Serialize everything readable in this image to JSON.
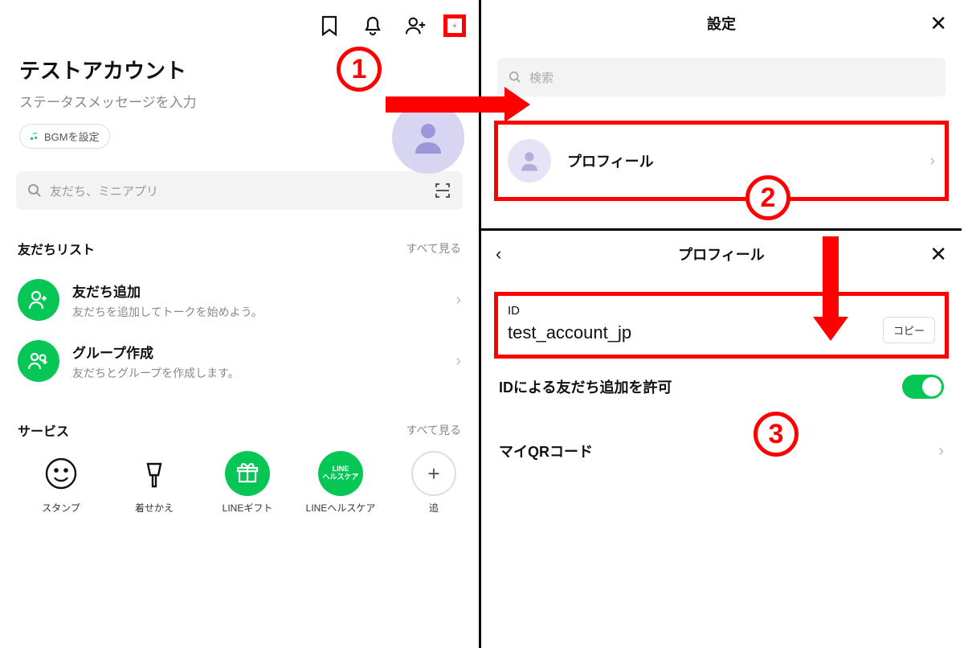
{
  "left": {
    "account_name": "テストアカウント",
    "status_placeholder": "ステータスメッセージを入力",
    "bgm_label": "BGMを設定",
    "search_placeholder": "友だち、ミニアプリ",
    "friends": {
      "title": "友だちリスト",
      "see_all": "すべて見る",
      "items": [
        {
          "title": "友だち追加",
          "sub": "友だちを追加してトークを始めよう。"
        },
        {
          "title": "グループ作成",
          "sub": "友だちとグループを作成します。"
        }
      ]
    },
    "services": {
      "title": "サービス",
      "see_all": "すべて見る",
      "items": [
        {
          "label": "スタンプ"
        },
        {
          "label": "着せかえ"
        },
        {
          "label": "LINEギフト"
        },
        {
          "label": "LINEヘルスケア"
        },
        {
          "label": "追"
        }
      ]
    }
  },
  "right": {
    "settings_title": "設定",
    "search_placeholder": "検索",
    "profile_label": "プロフィール",
    "detail": {
      "title": "プロフィール",
      "id_label": "ID",
      "id_value": "test_account_jp",
      "copy_label": "コピー",
      "allow_label": "IDによる友だち追加を許可",
      "qr_label": "マイQRコード"
    }
  },
  "annotations": {
    "a1": "1",
    "a2": "2",
    "a3": "3"
  }
}
